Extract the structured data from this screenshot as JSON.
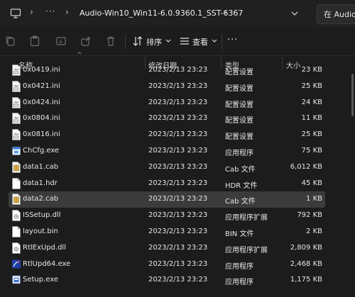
{
  "address": {
    "path": "Audio-Win10_Win11-6.0.9360.1_SST-6367",
    "search_placeholder": "在 Audio"
  },
  "toolbar": {
    "sort_label": "排序",
    "view_label": "查看"
  },
  "columns": {
    "name": "名称",
    "date": "修改日期",
    "type": "类型",
    "size": "大小"
  },
  "files": [
    {
      "name": "0x0419.ini",
      "date": "2023/2/13 23:23",
      "type": "配置设置",
      "size": "23 KB",
      "icon": "ini-file-icon"
    },
    {
      "name": "0x0421.ini",
      "date": "2023/2/13 23:23",
      "type": "配置设置",
      "size": "25 KB",
      "icon": "ini-file-icon"
    },
    {
      "name": "0x0424.ini",
      "date": "2023/2/13 23:23",
      "type": "配置设置",
      "size": "24 KB",
      "icon": "ini-file-icon"
    },
    {
      "name": "0x0804.ini",
      "date": "2023/2/13 23:23",
      "type": "配置设置",
      "size": "11 KB",
      "icon": "ini-file-icon"
    },
    {
      "name": "0x0816.ini",
      "date": "2023/2/13 23:23",
      "type": "配置设置",
      "size": "25 KB",
      "icon": "ini-file-icon"
    },
    {
      "name": "ChCfg.exe",
      "date": "2023/2/13 23:23",
      "type": "应用程序",
      "size": "75 KB",
      "icon": "exe-file-icon"
    },
    {
      "name": "data1.cab",
      "date": "2023/2/13 23:23",
      "type": "Cab 文件",
      "size": "6,012 KB",
      "icon": "cab-file-icon"
    },
    {
      "name": "data1.hdr",
      "date": "2023/2/13 23:23",
      "type": "HDR 文件",
      "size": "45 KB",
      "icon": "generic-file-icon"
    },
    {
      "name": "data2.cab",
      "date": "2023/2/13 23:23",
      "type": "Cab 文件",
      "size": "1 KB",
      "icon": "cab-file-icon",
      "selected": true
    },
    {
      "name": "ISSetup.dll",
      "date": "2023/2/13 23:23",
      "type": "应用程序扩展",
      "size": "792 KB",
      "icon": "dll-file-icon"
    },
    {
      "name": "layout.bin",
      "date": "2023/2/13 23:23",
      "type": "BIN 文件",
      "size": "2 KB",
      "icon": "generic-file-icon"
    },
    {
      "name": "RtlExUpd.dll",
      "date": "2023/2/13 23:23",
      "type": "应用程序扩展",
      "size": "2,809 KB",
      "icon": "dll-file-icon"
    },
    {
      "name": "RtlUpd64.exe",
      "date": "2023/2/13 23:23",
      "type": "应用程序",
      "size": "2,468 KB",
      "icon": "realtek-exe-icon"
    },
    {
      "name": "Setup.exe",
      "date": "2023/2/13 23:23",
      "type": "应用程序",
      "size": "1,175 KB",
      "icon": "setup-exe-icon"
    }
  ],
  "colors": {
    "selected_row": "#3b3b3b",
    "background": "#1c1c1c"
  }
}
